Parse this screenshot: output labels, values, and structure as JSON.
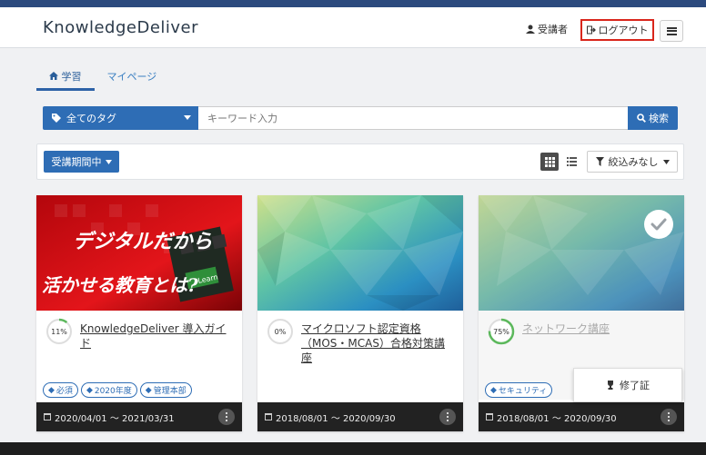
{
  "header": {
    "logo_part1": "Knowledge",
    "logo_part2": "Deliver",
    "user_label": "受講者",
    "logout_label": "ログアウト"
  },
  "tabs": [
    {
      "label": "学習"
    },
    {
      "label": "マイページ"
    }
  ],
  "search": {
    "tag_select": "全てのタグ",
    "placeholder": "キーワード入力",
    "button_label": "検索"
  },
  "filter": {
    "period_label": "受講期間中",
    "filter_label": "絞込みなし"
  },
  "cards": [
    {
      "progress": "11%",
      "progress_value": 11,
      "title": "KnowledgeDeliver 導入ガイド",
      "tags": [
        "必須",
        "2020年度",
        "管理本部"
      ],
      "period": "2020/04/01 ～ 2021/03/31",
      "thumb_text1": "デジタルだから",
      "thumb_text2": "活かせる教育とは?",
      "thumb_key": "Learn"
    },
    {
      "progress": "0%",
      "progress_value": 0,
      "title": "マイクロソフト認定資格（MOS・MCAS）合格対策講座",
      "tags": [],
      "period": "2018/08/01 ～ 2020/09/30"
    },
    {
      "progress": "75%",
      "progress_value": 75,
      "title": "ネットワーク講座",
      "tags": [
        "セキュリティ"
      ],
      "period": "2018/08/01 ～ 2020/09/30",
      "popup_label": "修了証"
    }
  ],
  "colors": {
    "primary": "#2e6db5",
    "logout_border": "#d9261c",
    "progress_ring": "#5cb85c"
  }
}
